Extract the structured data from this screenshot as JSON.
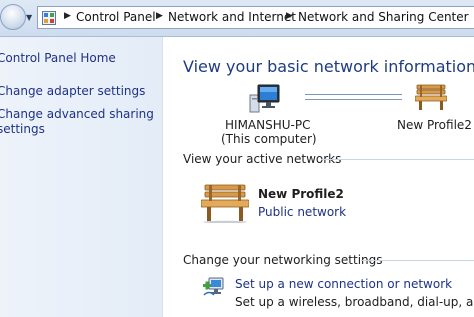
{
  "address_bar": {
    "breadcrumbs": [
      "Control Panel",
      "Network and Internet",
      "Network and Sharing Center"
    ]
  },
  "left_pane": {
    "links": [
      "Control Panel Home",
      "Change adapter settings",
      "Change advanced sharing",
      "settings"
    ]
  },
  "main": {
    "title": "View your basic network information and se",
    "network_map": {
      "computer_name": "HIMANSHU-PC",
      "computer_sub": "(This computer)",
      "network_name": "New Profile2"
    },
    "active_networks": {
      "heading": "View your active networks",
      "name": "New Profile2",
      "type": "Public network"
    },
    "settings": {
      "heading": "Change your networking settings",
      "setup_link": "Set up a new connection or network",
      "setup_desc": "Set up a wireless, broadband, dial-up, ad hoc, o"
    }
  }
}
